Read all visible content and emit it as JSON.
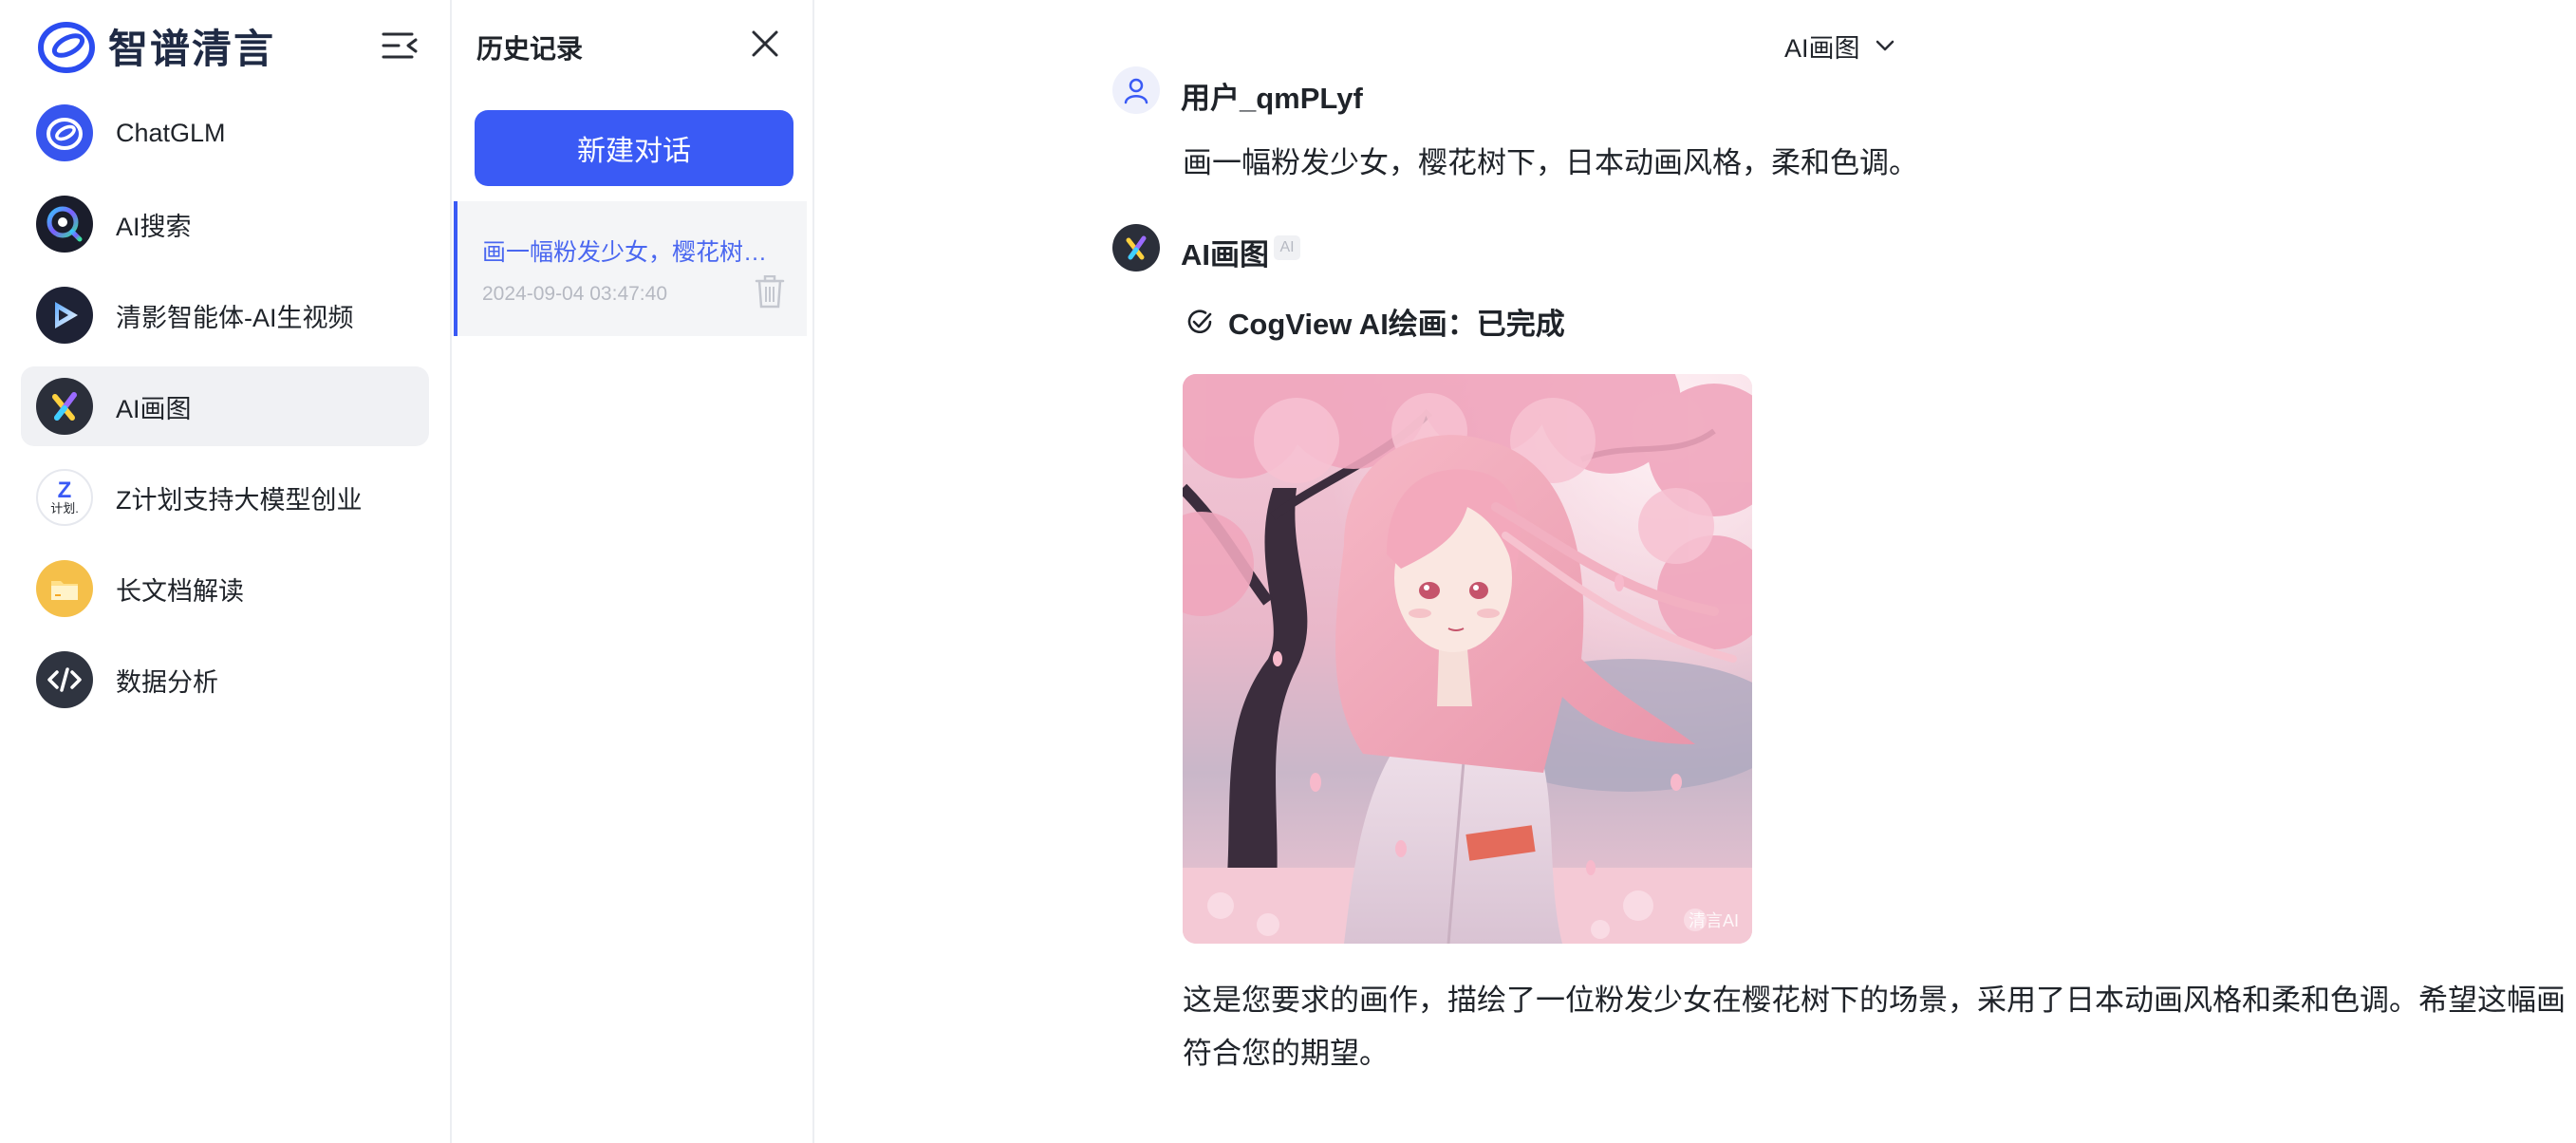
{
  "brand": {
    "name": "智谱清言"
  },
  "nav": {
    "items": [
      {
        "label": "ChatGLM",
        "icon": "chatglm-icon",
        "active": false
      },
      {
        "label": "AI搜索",
        "icon": "ai-search-icon",
        "active": false
      },
      {
        "label": "清影智能体-AI生视频",
        "icon": "video-play-icon",
        "active": false
      },
      {
        "label": "AI画图",
        "icon": "ai-draw-icon",
        "active": true
      },
      {
        "label": "Z计划支持大模型创业",
        "icon": "z-plan-icon",
        "badge": "Z",
        "badge_sub": "计划.",
        "active": false
      },
      {
        "label": "长文档解读",
        "icon": "folder-icon",
        "active": false
      },
      {
        "label": "数据分析",
        "icon": "code-icon",
        "active": false
      }
    ]
  },
  "history": {
    "title": "历史记录",
    "new_chat_label": "新建对话",
    "items": [
      {
        "title": "画一幅粉发少女，樱花树下，日本动画风格，柔和色调。",
        "time": "2024-09-04 03:47:40"
      }
    ]
  },
  "main": {
    "model_selector": "AI画图",
    "user": {
      "name": "用户_qmPLyf",
      "message": "画一幅粉发少女，樱花树下，日本动画风格，柔和色调。"
    },
    "bot": {
      "name": "AI画图",
      "badge": "AI",
      "status": "CogView AI绘画：已完成",
      "watermark": "清言AI",
      "reply": "这是您要求的画作，描绘了一位粉发少女在樱花树下的场景，采用了日本动画风格和柔和色调。希望这幅画符合您的期望。"
    }
  },
  "colors": {
    "accent": "#3a5af5",
    "active_nav_bg": "#f0f1f4",
    "muted_text": "#b6b9c2"
  }
}
